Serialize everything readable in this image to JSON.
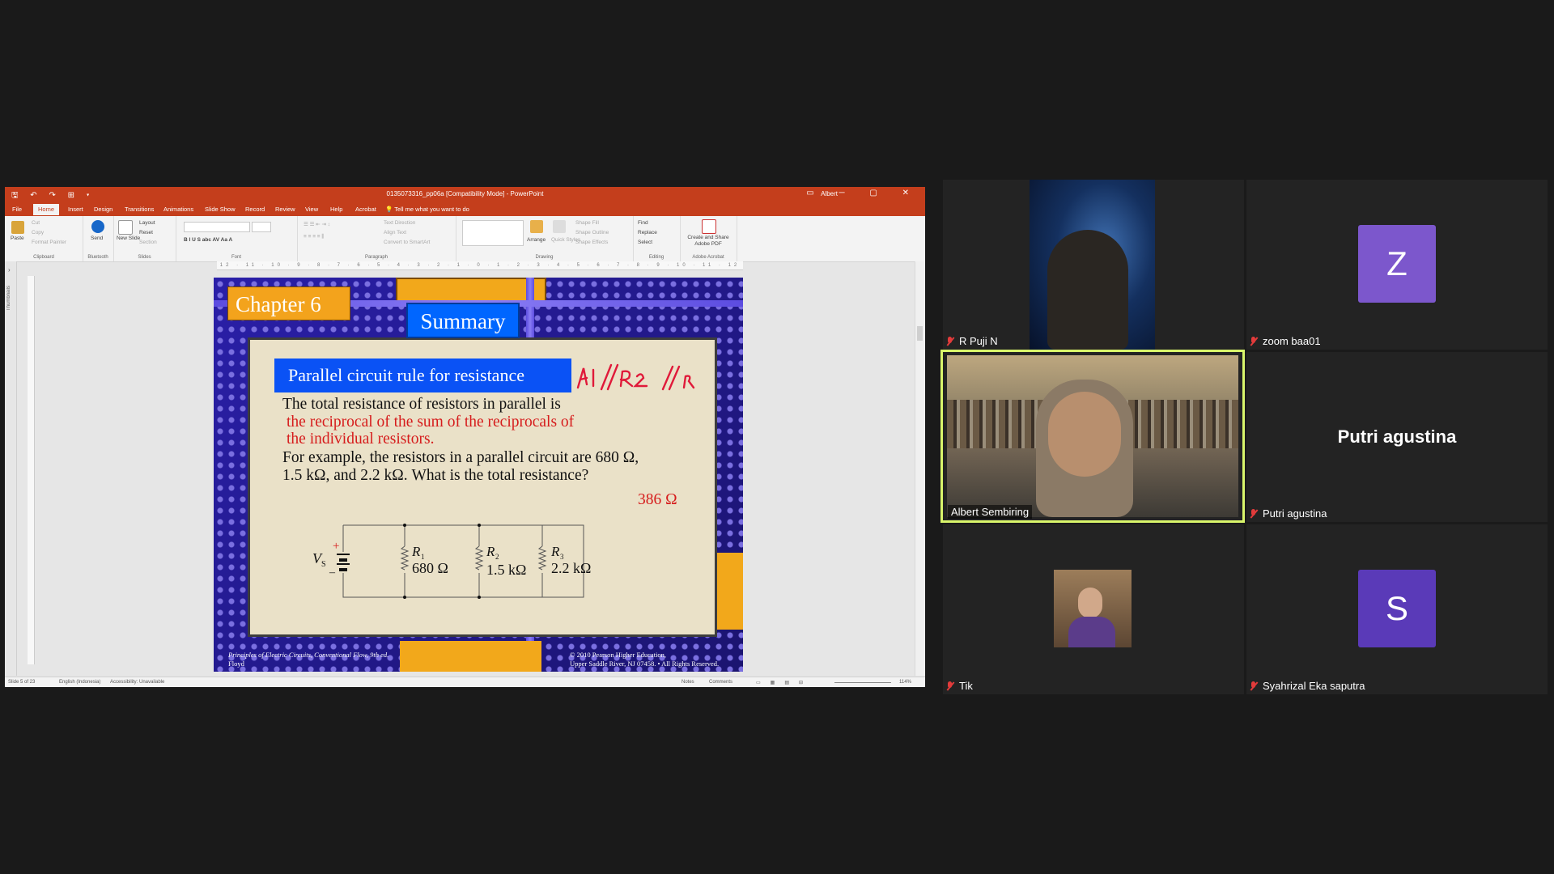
{
  "ppt": {
    "quick_access": "🖫 ↶ ↷ ⊞ ▾",
    "doc_title": "0135073316_pp06a [Compatibility Mode]  -  PowerPoint",
    "user": "Albert",
    "window_buttons": "▭ ─ ▢ ✕",
    "tabs": [
      "File",
      "Home",
      "Insert",
      "Design",
      "Transitions",
      "Animations",
      "Slide Show",
      "Record",
      "Review",
      "View",
      "Help",
      "Acrobat"
    ],
    "tell_me": "Tell me what you want to do",
    "ribbon": {
      "clipboard": {
        "label": "Clipboard",
        "paste": "Paste",
        "cut": "Cut",
        "copy": "Copy",
        "format_painter": "Format Painter"
      },
      "bluetooth": {
        "label": "Bluetooth",
        "send": "Send"
      },
      "slides": {
        "label": "Slides",
        "new_slide": "New Slide",
        "layout": "Layout",
        "reset": "Reset",
        "section": "Section"
      },
      "font": {
        "label": "Font"
      },
      "paragraph": {
        "label": "Paragraph",
        "text_direction": "Text Direction",
        "align_text": "Align Text",
        "smartart": "Convert to SmartArt"
      },
      "drawing": {
        "label": "Drawing",
        "arrange": "Arrange",
        "quick_styles": "Quick Styles",
        "shape_fill": "Shape Fill",
        "shape_outline": "Shape Outline",
        "shape_effects": "Shape Effects"
      },
      "editing": {
        "label": "Editing",
        "find": "Find",
        "replace": "Replace",
        "select": "Select"
      },
      "acrobat": {
        "label": "Adobe Acrobat",
        "create_share": "Create and Share Adobe PDF"
      }
    },
    "thumbnails_label": "Thumbnails",
    "ruler_text": "12 · 11 · 10 · 9 · 8 · 7 · 6 · 5 · 4 · 3 · 2 · 1 · 0 · 1 · 2 · 3 · 4 · 5 · 6 · 7 · 8 · 9 · 10 · 11 · 12",
    "status": {
      "slide": "Slide 5 of 23",
      "language": "English (Indonesia)",
      "accessibility": "Accessibility: Unavailable",
      "notes": "Notes",
      "comments": "Comments",
      "zoom": "114%"
    }
  },
  "slide": {
    "chapter": "Chapter 6",
    "summary": "Summary",
    "rule_title": "Parallel circuit rule for resistance",
    "ink_note": "R1//R2 //R",
    "line1": "The total resistance of resistors in parallel is",
    "line2": "the reciprocal of the sum of the reciprocals of",
    "line3": "the individual resistors.",
    "line4": "For example, the resistors in a parallel circuit are 680 Ω,",
    "line5": "1.5 kΩ,  and 2.2 kΩ. What is the total resistance?",
    "answer": "386 Ω",
    "circuit": {
      "source_label": "V",
      "source_sub": "S",
      "plus": "+",
      "minus": "–",
      "resistors": [
        {
          "name": "R",
          "sub": "1",
          "value": "680 Ω"
        },
        {
          "name": "R",
          "sub": "2",
          "value": "1.5 kΩ"
        },
        {
          "name": "R",
          "sub": "3",
          "value": "2.2 kΩ"
        }
      ]
    },
    "footer_left_1": "Principles of Electric Circuits, Conventional Flow,  9th ed.",
    "footer_left_2": "Floyd",
    "footer_right_1": "© 2010 Pearson Higher Education,",
    "footer_right_2": "Upper Saddle River, NJ 07458. • All Rights Reserved."
  },
  "participants": [
    {
      "name": "R Puji N",
      "muted": true,
      "type": "video"
    },
    {
      "name": "zoom baa01",
      "muted": true,
      "type": "avatar",
      "initial": "Z"
    },
    {
      "name": "Albert Sembiring",
      "muted": false,
      "type": "video",
      "active_speaker": true
    },
    {
      "name": "Putri agustina",
      "muted": true,
      "type": "name"
    },
    {
      "name": "Tik",
      "muted": true,
      "type": "video"
    },
    {
      "name": "Syahrizal Eka saputra",
      "muted": true,
      "type": "avatar",
      "initial": "S"
    }
  ],
  "colors": {
    "ppt_accent": "#c43e1c",
    "active_speaker_border": "#d9f56b",
    "avatar_purple": "#7c57cc",
    "slide_blue": "#0a52f5",
    "slide_red": "#d61c1c"
  }
}
